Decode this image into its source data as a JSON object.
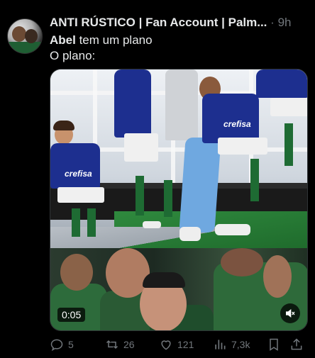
{
  "tweet": {
    "author": "ANTI RÚSTICO | Fan Account | Palm...",
    "separator": "·",
    "time": "9h",
    "text_bold": "Abel",
    "text_line1_rest": " tem um plano",
    "text_line2": "O plano:",
    "video_duration": "0:05",
    "sponsor_jersey_text": "crefisa"
  },
  "actions": {
    "replies": "5",
    "retweets": "26",
    "likes": "121",
    "views": "7,3k"
  },
  "icons": [
    "reply-icon",
    "retweet-icon",
    "like-icon",
    "views-icon",
    "bookmark-icon",
    "share-icon",
    "mute-icon"
  ],
  "colors": {
    "background": "#000000",
    "text": "#e7e9ea",
    "muted": "#71767b",
    "palmeiras_green": "#1e6b33",
    "jersey_blue": "#1d2f8f"
  }
}
